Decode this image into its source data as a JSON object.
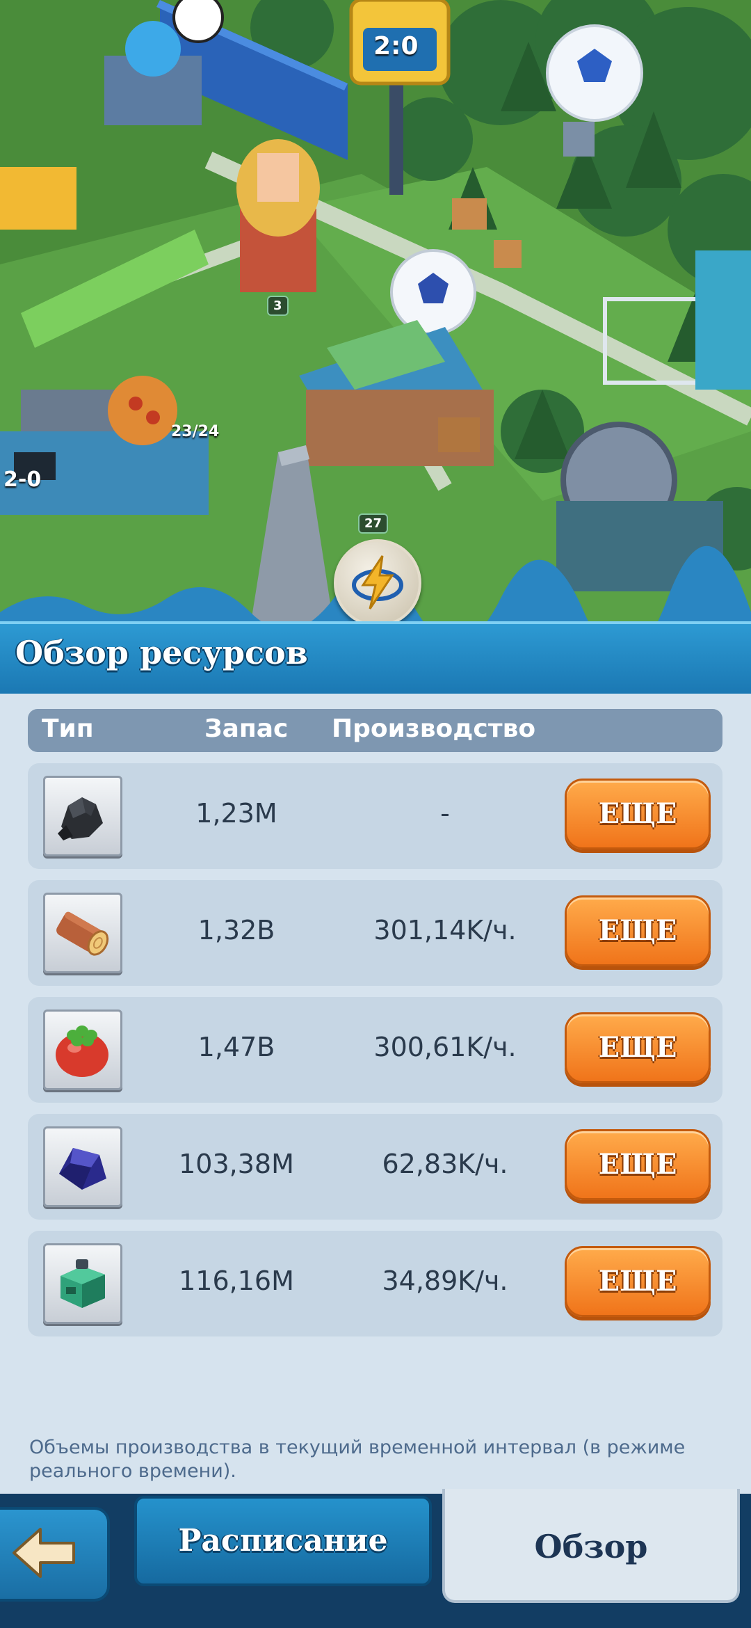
{
  "world": {
    "scoreboard": "2:0",
    "level_badge_1": "3",
    "pizza_counter": "23/24",
    "level_badge_2": "27",
    "side_score": "2-0"
  },
  "panel": {
    "title": "Обзор ресурсов",
    "columns": {
      "type": "Тип",
      "stock": "Запас",
      "production": "Производство"
    },
    "rows": [
      {
        "icon": "coal-icon",
        "stock": "1,23M",
        "production": "-",
        "button": "ЕЩЕ"
      },
      {
        "icon": "wood-log-icon",
        "stock": "1,32B",
        "production": "301,14K/ч.",
        "button": "ЕЩЕ"
      },
      {
        "icon": "tomato-icon",
        "stock": "1,47B",
        "production": "300,61K/ч.",
        "button": "ЕЩЕ"
      },
      {
        "icon": "crystal-icon",
        "stock": "103,38M",
        "production": "62,83K/ч.",
        "button": "ЕЩЕ"
      },
      {
        "icon": "green-box-icon",
        "stock": "116,16M",
        "production": "34,89K/ч.",
        "button": "ЕЩЕ"
      }
    ],
    "footnote": "Объемы производства в текущий временной интервал (в режиме реального времени)."
  },
  "bottom": {
    "schedule_tab": "Расписание",
    "overview_tab": "Обзор",
    "active_tab": "Обзор"
  },
  "colors": {
    "header_blue": "#1b78b3",
    "button_orange": "#f0741a",
    "panel_bg": "#d6e3ee"
  }
}
